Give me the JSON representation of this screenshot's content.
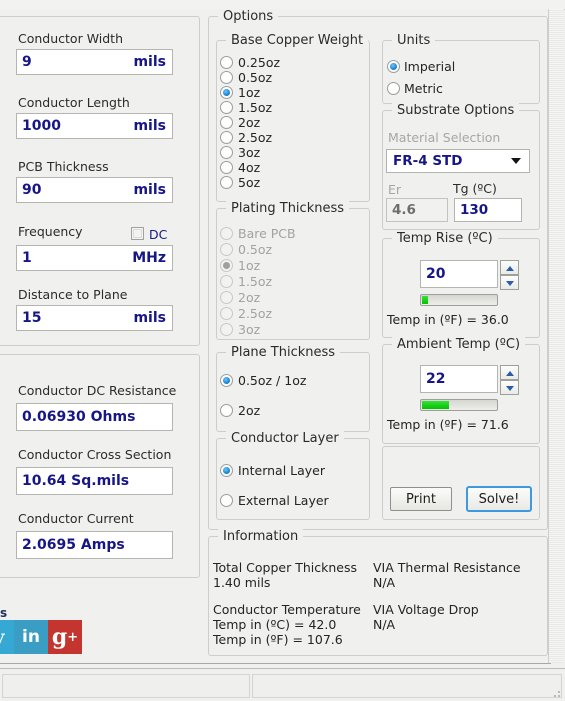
{
  "left_inputs": {
    "fields": [
      {
        "label": "Conductor Width",
        "value": "9",
        "unit": "mils",
        "name": "conductor-width"
      },
      {
        "label": "Conductor Length",
        "value": "1000",
        "unit": "mils",
        "name": "conductor-length"
      },
      {
        "label": "PCB Thickness",
        "value": "90",
        "unit": "mils",
        "name": "pcb-thickness"
      },
      {
        "label": "Frequency",
        "value": "1",
        "unit": "MHz",
        "name": "frequency"
      },
      {
        "label": "Distance to Plane",
        "value": "15",
        "unit": "mils",
        "name": "distance-to-plane"
      }
    ],
    "dc_checkbox": {
      "label": "DC",
      "checked": false
    }
  },
  "left_results": {
    "fields": [
      {
        "label": "Conductor DC Resistance",
        "value": "0.06930 Ohms",
        "name": "conductor-dc-resistance"
      },
      {
        "label": "Conductor Cross Section",
        "value": "10.64 Sq.mils",
        "name": "conductor-cross-section"
      },
      {
        "label": "Conductor Current",
        "value": "2.0695 Amps",
        "name": "conductor-current"
      }
    ]
  },
  "social": {
    "label": "s",
    "items": [
      {
        "name": "twitter-icon",
        "glyph": "✈"
      },
      {
        "name": "linkedin-icon",
        "glyph": "in"
      },
      {
        "name": "googleplus-icon",
        "glyph": "g"
      }
    ]
  },
  "options": {
    "title": "Options",
    "base_copper_weight": {
      "title": "Base Copper Weight",
      "selected": "1oz",
      "options": [
        "0.25oz",
        "0.5oz",
        "1oz",
        "1.5oz",
        "2oz",
        "2.5oz",
        "3oz",
        "4oz",
        "5oz"
      ]
    },
    "plating_thickness": {
      "title": "Plating Thickness",
      "disabled": true,
      "selected": "1oz",
      "options": [
        "Bare PCB",
        "0.5oz",
        "1oz",
        "1.5oz",
        "2oz",
        "2.5oz",
        "3oz"
      ]
    },
    "plane_thickness": {
      "title": "Plane Thickness",
      "selected": "0.5oz / 1oz",
      "options": [
        "0.5oz / 1oz",
        "2oz"
      ]
    },
    "conductor_layer": {
      "title": "Conductor Layer",
      "selected": "Internal Layer",
      "options": [
        "Internal Layer",
        "External Layer"
      ]
    },
    "units": {
      "title": "Units",
      "selected": "Imperial",
      "options": [
        "Imperial",
        "Metric"
      ]
    },
    "substrate": {
      "title": "Substrate Options",
      "material_label": "Material Selection",
      "material_value": "FR-4 STD",
      "er_label": "Er",
      "er_value": "4.6",
      "tg_label": "Tg (ºC)",
      "tg_value": "130"
    },
    "temp_rise": {
      "title": "Temp Rise (ºC)",
      "value": "20",
      "progress_percent": 8,
      "readout": "Temp in (ºF) = 36.0"
    },
    "ambient_temp": {
      "title": "Ambient Temp (ºC)",
      "value": "22",
      "progress_percent": 36,
      "readout": "Temp in (ºF) = 71.6"
    },
    "actions": {
      "print_label": "Print",
      "solve_label": "Solve!"
    }
  },
  "information": {
    "title": "Information",
    "col1": [
      {
        "heading": "Total Copper Thickness",
        "lines": [
          "1.40 mils"
        ]
      },
      {
        "heading": "Conductor Temperature",
        "lines": [
          "Temp in (ºC) = 42.0",
          "Temp in (ºF) = 107.6"
        ]
      }
    ],
    "col2": [
      {
        "heading": "VIA Thermal Resistance",
        "lines": [
          "N/A"
        ]
      },
      {
        "heading": "VIA Voltage Drop",
        "lines": [
          "N/A"
        ]
      }
    ]
  }
}
